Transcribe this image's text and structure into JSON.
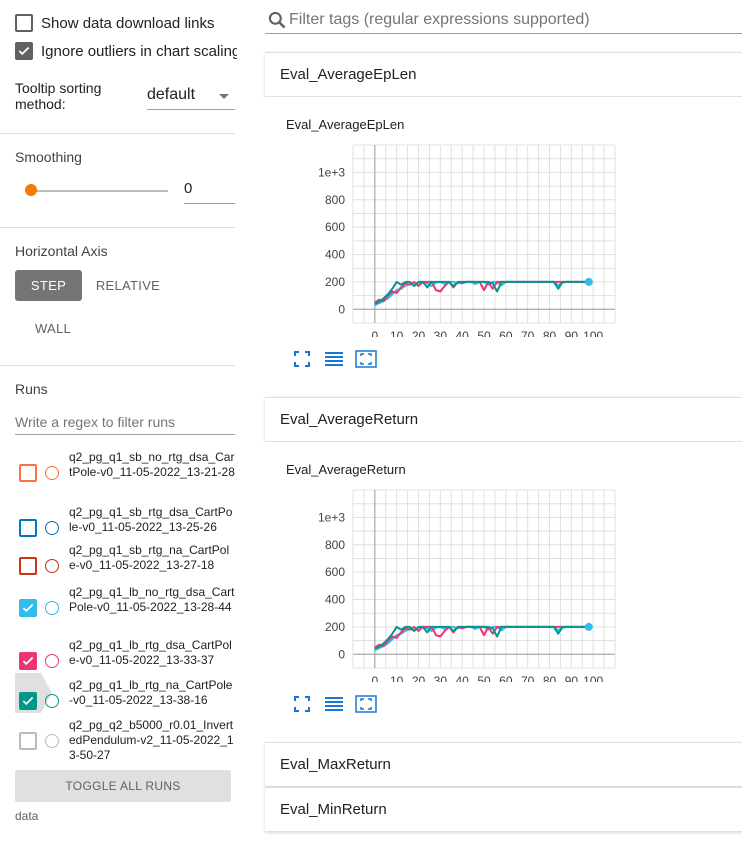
{
  "sidebar": {
    "show_download_links": {
      "label": "Show data download links",
      "checked": false
    },
    "ignore_outliers": {
      "label": "Ignore outliers in chart scaling",
      "checked": true
    },
    "tooltip_sorting": {
      "label": "Tooltip sorting method:",
      "value": "default"
    },
    "smoothing": {
      "title": "Smoothing",
      "value": "0"
    },
    "horizontal_axis": {
      "title": "Horizontal Axis",
      "options": [
        "STEP",
        "RELATIVE",
        "WALL"
      ],
      "selected": "STEP"
    },
    "runs": {
      "title": "Runs",
      "filter_placeholder": "Write a regex to filter runs",
      "items": [
        {
          "name": "q2_pg_q1_sb_no_rtg_dsa_CartPole-v0_11-05-2022_13-21-28",
          "color": "#ff7043",
          "checked": false
        },
        {
          "name": "q2_pg_q1_sb_rtg_dsa_CartPole-v0_11-05-2022_13-25-26",
          "color": "#0077bb",
          "checked": false
        },
        {
          "name": "q2_pg_q1_sb_rtg_na_CartPole-v0_11-05-2022_13-27-18",
          "color": "#cc3311",
          "checked": false
        },
        {
          "name": "q2_pg_q1_lb_no_rtg_dsa_CartPole-v0_11-05-2022_13-28-44",
          "color": "#33bbee",
          "checked": true
        },
        {
          "name": "q2_pg_q1_lb_rtg_dsa_CartPole-v0_11-05-2022_13-33-37",
          "color": "#ee3377",
          "checked": true
        },
        {
          "name": "q2_pg_q1_lb_rtg_na_CartPole-v0_11-05-2022_13-38-16",
          "color": "#009988",
          "checked": true
        },
        {
          "name": "q2_pg_q2_b5000_r0.01_InvertedPendulum-v2_11-05-2022_13-50-27",
          "color": "#bbbbbb",
          "checked": false
        }
      ],
      "toggle_all_label": "TOGGLE ALL RUNS",
      "data_dir": "data"
    }
  },
  "main": {
    "filter_placeholder": "Filter tags (regular expressions supported)",
    "cards": [
      {
        "title": "Eval_AverageEpLen",
        "chart_title": "Eval_AverageEpLen"
      },
      {
        "title": "Eval_AverageReturn",
        "chart_title": "Eval_AverageReturn"
      },
      {
        "title": "Eval_MaxReturn"
      },
      {
        "title": "Eval_MinReturn"
      }
    ]
  },
  "chart_data": [
    {
      "type": "line",
      "title": "Eval_AverageEpLen",
      "x_ticks": [
        "0",
        "10",
        "20",
        "30",
        "40",
        "50",
        "60",
        "70",
        "80",
        "90",
        "100"
      ],
      "y_ticks": [
        "0",
        "200",
        "400",
        "600",
        "800",
        "1e+3"
      ],
      "xlim": [
        -10,
        110
      ],
      "ylim": [
        -100,
        1200
      ],
      "series": [
        {
          "color": "#33bbee",
          "x": [
            0,
            2,
            4,
            6,
            8,
            10,
            12,
            14,
            16,
            18,
            20,
            22,
            24,
            26,
            28,
            30,
            32,
            34,
            36,
            38,
            40,
            42,
            44,
            46,
            48,
            50,
            52,
            54,
            56,
            58,
            60,
            62,
            64,
            66,
            68,
            70,
            72,
            74,
            76,
            78,
            80,
            82,
            84,
            86,
            88,
            90,
            92,
            94,
            96,
            98
          ],
          "values": [
            30,
            45,
            60,
            80,
            110,
            140,
            150,
            170,
            185,
            175,
            195,
            200,
            190,
            170,
            195,
            200,
            185,
            200,
            200,
            190,
            200,
            200,
            200,
            185,
            200,
            200,
            180,
            200,
            200,
            175,
            200,
            200,
            200,
            200,
            200,
            200,
            200,
            200,
            200,
            200,
            200,
            200,
            175,
            195,
            200,
            200,
            200,
            200,
            200,
            200
          ]
        },
        {
          "color": "#ee3377",
          "x": [
            0,
            2,
            4,
            6,
            8,
            10,
            12,
            14,
            16,
            18,
            20,
            22,
            24,
            26,
            28,
            30,
            32,
            34,
            36,
            38,
            40,
            42,
            44,
            46,
            48,
            50,
            52,
            54,
            56,
            58,
            60,
            62,
            64,
            66,
            68,
            70,
            72,
            74,
            76,
            78,
            80,
            82,
            84,
            86,
            88,
            90,
            92,
            94,
            96,
            98
          ],
          "values": [
            50,
            70,
            60,
            100,
            130,
            120,
            160,
            190,
            180,
            200,
            170,
            200,
            200,
            200,
            140,
            130,
            170,
            200,
            160,
            200,
            190,
            200,
            200,
            200,
            200,
            140,
            200,
            150,
            200,
            200,
            200,
            200,
            200,
            200,
            200,
            200,
            200,
            200,
            200,
            200,
            200,
            200,
            200,
            200,
            200,
            200,
            200,
            200,
            200,
            200
          ]
        },
        {
          "color": "#009988",
          "x": [
            0,
            2,
            4,
            6,
            8,
            10,
            12,
            14,
            16,
            18,
            20,
            22,
            24,
            26,
            28,
            30,
            32,
            34,
            36,
            38,
            40,
            42,
            44,
            46,
            48,
            50,
            52,
            54,
            56,
            58,
            60,
            62,
            64,
            66,
            68,
            70,
            72,
            74,
            76,
            78,
            80,
            82,
            84,
            86,
            88,
            90,
            92,
            94,
            96,
            98
          ],
          "values": [
            40,
            55,
            80,
            110,
            150,
            200,
            180,
            200,
            200,
            170,
            200,
            200,
            160,
            200,
            200,
            200,
            200,
            200,
            170,
            200,
            200,
            200,
            200,
            200,
            200,
            200,
            200,
            190,
            130,
            200,
            200,
            200,
            200,
            200,
            200,
            200,
            200,
            200,
            200,
            200,
            200,
            200,
            150,
            200,
            200,
            200,
            200,
            200,
            200,
            200
          ]
        }
      ]
    },
    {
      "type": "line",
      "title": "Eval_AverageReturn",
      "x_ticks": [
        "0",
        "10",
        "20",
        "30",
        "40",
        "50",
        "60",
        "70",
        "80",
        "90",
        "100"
      ],
      "y_ticks": [
        "0",
        "200",
        "400",
        "600",
        "800",
        "1e+3"
      ],
      "xlim": [
        -10,
        110
      ],
      "ylim": [
        -100,
        1200
      ],
      "series": [
        {
          "color": "#33bbee",
          "x": [
            0,
            2,
            4,
            6,
            8,
            10,
            12,
            14,
            16,
            18,
            20,
            22,
            24,
            26,
            28,
            30,
            32,
            34,
            36,
            38,
            40,
            42,
            44,
            46,
            48,
            50,
            52,
            54,
            56,
            58,
            60,
            62,
            64,
            66,
            68,
            70,
            72,
            74,
            76,
            78,
            80,
            82,
            84,
            86,
            88,
            90,
            92,
            94,
            96,
            98
          ],
          "values": [
            30,
            45,
            60,
            80,
            110,
            140,
            150,
            170,
            185,
            175,
            195,
            200,
            190,
            170,
            195,
            200,
            185,
            200,
            200,
            190,
            200,
            200,
            200,
            185,
            200,
            200,
            180,
            200,
            200,
            175,
            200,
            200,
            200,
            200,
            200,
            200,
            200,
            200,
            200,
            200,
            200,
            200,
            175,
            195,
            200,
            200,
            200,
            200,
            200,
            200
          ]
        },
        {
          "color": "#ee3377",
          "x": [
            0,
            2,
            4,
            6,
            8,
            10,
            12,
            14,
            16,
            18,
            20,
            22,
            24,
            26,
            28,
            30,
            32,
            34,
            36,
            38,
            40,
            42,
            44,
            46,
            48,
            50,
            52,
            54,
            56,
            58,
            60,
            62,
            64,
            66,
            68,
            70,
            72,
            74,
            76,
            78,
            80,
            82,
            84,
            86,
            88,
            90,
            92,
            94,
            96,
            98
          ],
          "values": [
            50,
            70,
            60,
            100,
            130,
            120,
            160,
            190,
            180,
            200,
            170,
            200,
            200,
            200,
            140,
            130,
            170,
            200,
            160,
            200,
            190,
            200,
            200,
            200,
            200,
            140,
            200,
            150,
            200,
            200,
            200,
            200,
            200,
            200,
            200,
            200,
            200,
            200,
            200,
            200,
            200,
            200,
            200,
            200,
            200,
            200,
            200,
            200,
            200,
            200
          ]
        },
        {
          "color": "#009988",
          "x": [
            0,
            2,
            4,
            6,
            8,
            10,
            12,
            14,
            16,
            18,
            20,
            22,
            24,
            26,
            28,
            30,
            32,
            34,
            36,
            38,
            40,
            42,
            44,
            46,
            48,
            50,
            52,
            54,
            56,
            58,
            60,
            62,
            64,
            66,
            68,
            70,
            72,
            74,
            76,
            78,
            80,
            82,
            84,
            86,
            88,
            90,
            92,
            94,
            96,
            98
          ],
          "values": [
            40,
            55,
            80,
            110,
            150,
            200,
            180,
            200,
            200,
            170,
            200,
            200,
            160,
            200,
            200,
            200,
            200,
            200,
            170,
            200,
            200,
            200,
            200,
            200,
            200,
            200,
            200,
            190,
            130,
            200,
            200,
            200,
            200,
            200,
            200,
            200,
            200,
            200,
            200,
            200,
            200,
            200,
            150,
            200,
            200,
            200,
            200,
            200,
            200,
            200
          ]
        }
      ]
    }
  ]
}
